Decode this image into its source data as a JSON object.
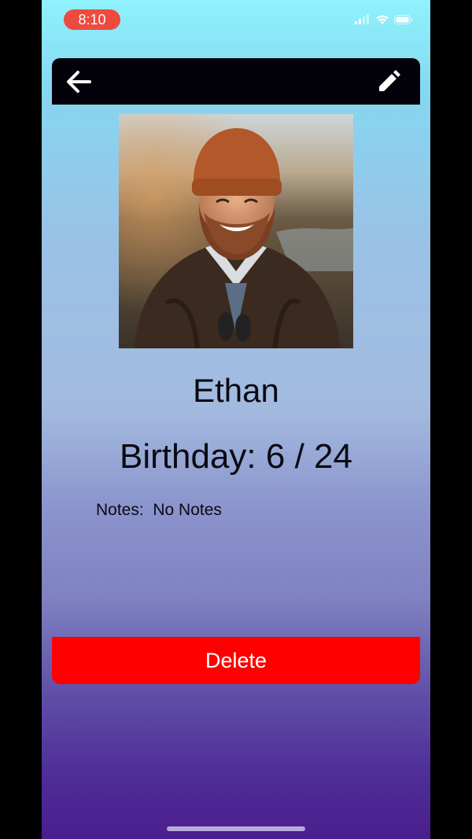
{
  "status_bar": {
    "time": "8:10",
    "time_pill_color": "#ee4a3f",
    "icons": [
      "cellular-signal-icon",
      "wifi-icon",
      "battery-icon"
    ]
  },
  "header": {
    "back_icon": "arrow-left-icon",
    "edit_icon": "pencil-icon",
    "background": "#03020a"
  },
  "profile": {
    "photo": "portrait of a bearded man in an orange beanie and brown jacket",
    "name": "Ethan",
    "birthday": "Birthday: 6 / 24",
    "notes": "Notes:  No Notes"
  },
  "actions": {
    "delete_label": "Delete",
    "delete_color": "#ff0000"
  }
}
